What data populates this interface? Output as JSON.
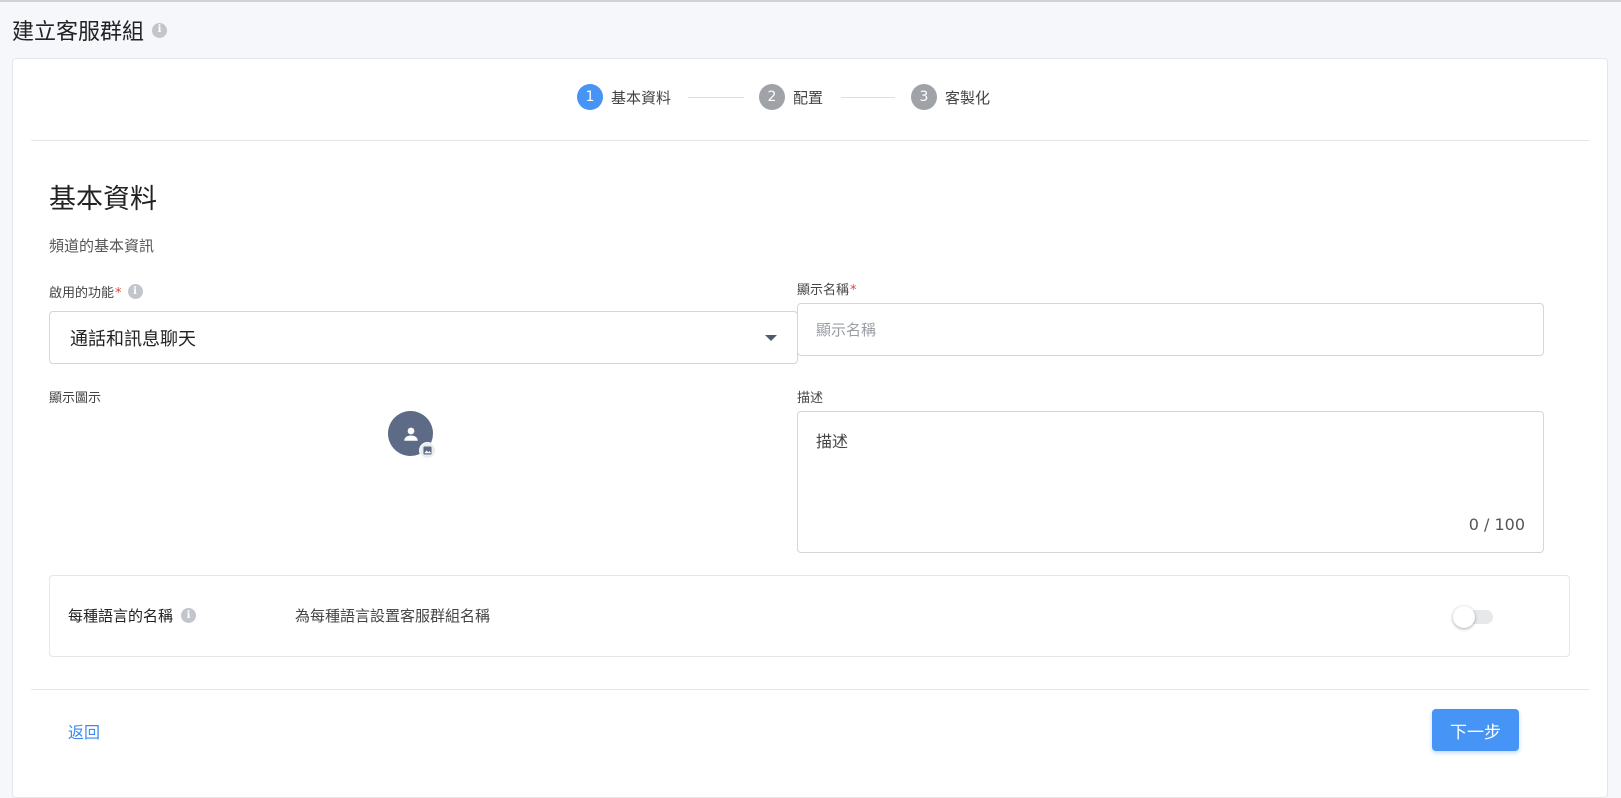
{
  "page": {
    "title": "建立客服群組",
    "title_info_icon": "info-icon"
  },
  "stepper": {
    "steps": [
      {
        "number": "1",
        "label": "基本資料",
        "state": "active"
      },
      {
        "number": "2",
        "label": "配置",
        "state": "inactive"
      },
      {
        "number": "3",
        "label": "客製化",
        "state": "inactive"
      }
    ]
  },
  "section": {
    "title": "基本資料",
    "subtitle": "頻道的基本資訊"
  },
  "features": {
    "label": "啟用的功能",
    "required_mark": "*",
    "selected_value": "通話和訊息聊天"
  },
  "display_name": {
    "label": "顯示名稱",
    "required_mark": "*",
    "placeholder": "顯示名稱",
    "value": ""
  },
  "display_icon": {
    "label": "顯示圖示",
    "avatar_icon": "user-icon",
    "badge_icon": "image-icon"
  },
  "description": {
    "label": "描述",
    "placeholder": "描述",
    "counter": "0 / 100"
  },
  "language_names": {
    "title": "每種語言的名稱",
    "description": "為每種語言設置客服群組名稱",
    "toggle_on": false
  },
  "footer": {
    "back_label": "返回",
    "next_label": "下一步"
  },
  "colors": {
    "accent": "#4694f5",
    "inactive_step": "#9fa2a6",
    "required": "#e0463c",
    "avatar_bg": "#5d6b86"
  }
}
